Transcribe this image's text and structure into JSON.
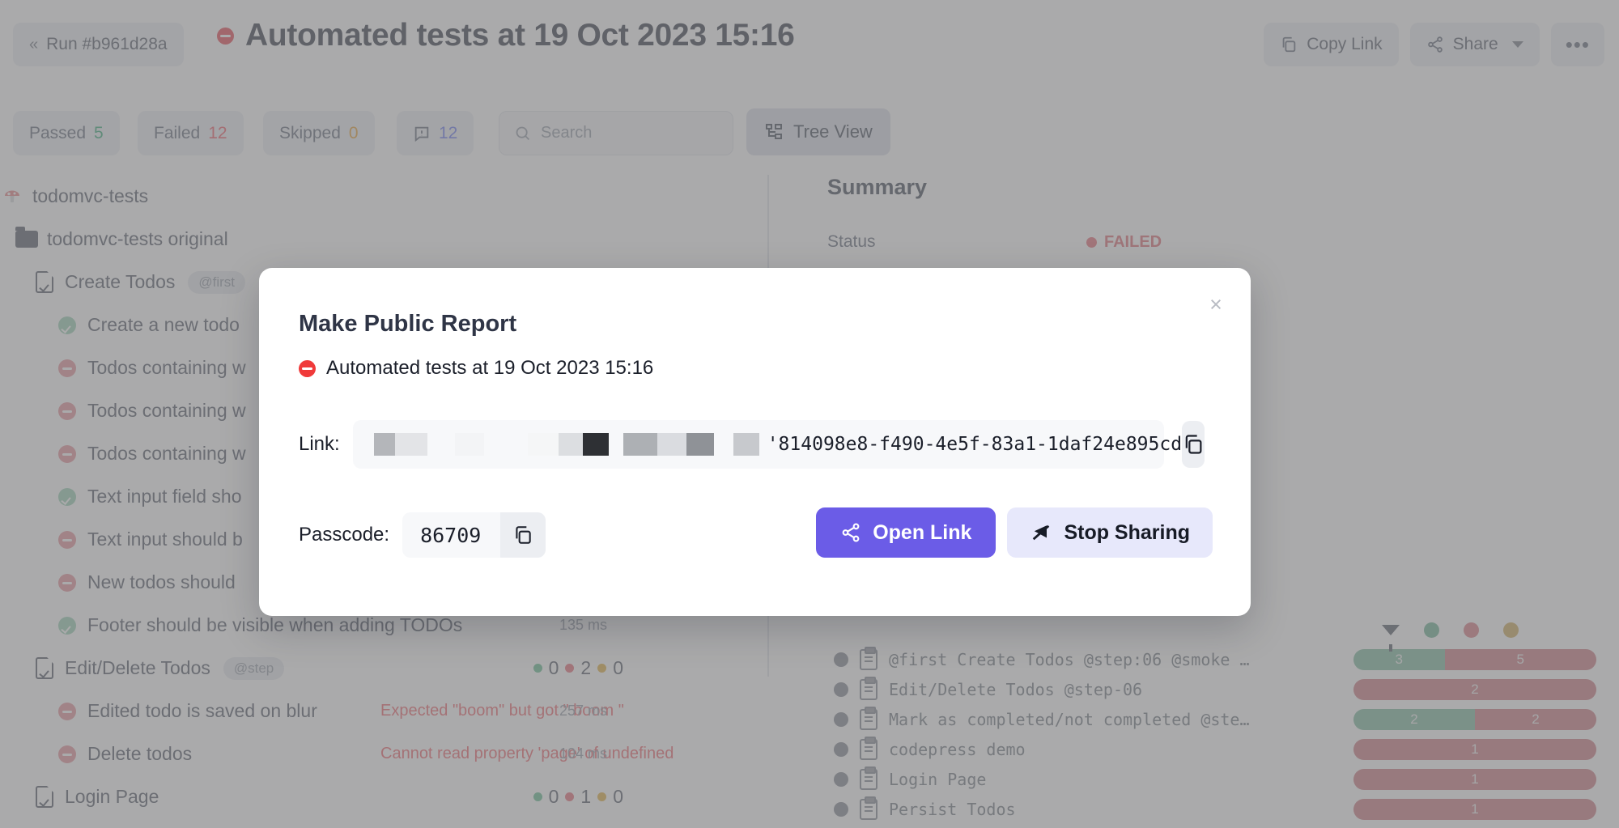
{
  "header": {
    "run_chip": "Run #b961d28a",
    "back_icon": "chevron-double-left-icon",
    "title": "Automated tests at 19 Oct 2023 15:16",
    "status_icon": "failed-circle-icon",
    "copy_link_label": "Copy Link",
    "share_label": "Share",
    "more_label": "•••"
  },
  "filters": {
    "passed_label": "Passed",
    "passed_count": "5",
    "failed_label": "Failed",
    "failed_count": "12",
    "skipped_label": "Skipped",
    "skipped_count": "0",
    "notes_count": "12",
    "search_placeholder": "Search",
    "search_value": "",
    "tree_view_label": "Tree View"
  },
  "tree": {
    "root": "todomvc-tests",
    "folder": "todomvc-tests original",
    "suite1": {
      "name": "Create Todos",
      "tag": "@first"
    },
    "tests1": [
      {
        "status": "passed",
        "name": "Create a new todo"
      },
      {
        "status": "failed",
        "name": "Todos containing w"
      },
      {
        "status": "failed",
        "name": "Todos containing w"
      },
      {
        "status": "failed",
        "name": "Todos containing w"
      },
      {
        "status": "passed",
        "name": "Text input field sho"
      },
      {
        "status": "failed",
        "name": "Text input should b"
      },
      {
        "status": "failed",
        "name": "New todos should"
      },
      {
        "status": "passed",
        "name": "Footer should be visible when adding TODOs",
        "duration": "135 ms"
      }
    ],
    "suite2": {
      "name": "Edit/Delete Todos",
      "tag": "@step",
      "pass": "0",
      "fail": "2",
      "skip": "0"
    },
    "tests2": [
      {
        "status": "failed",
        "name": "Edited todo is saved on blur",
        "error": "Expected \"boom\" but got \" boom \"",
        "duration": "257 ms"
      },
      {
        "status": "failed",
        "name": "Delete todos",
        "error": "Cannot read property 'page' of undefined",
        "duration": "104 ms"
      }
    ],
    "suite3": {
      "name": "Login Page",
      "pass": "0",
      "fail": "1",
      "skip": "0"
    }
  },
  "summary": {
    "title": "Summary",
    "status_label": "Status",
    "status_value": "FAILED"
  },
  "suites_panel": {
    "legend": [
      "filter-funnel-icon",
      "passed-dot",
      "failed-dot",
      "skipped-dot"
    ],
    "rows": [
      {
        "name": "@first Create Todos @step:06 @smoke …",
        "passed": 3,
        "failed": 5
      },
      {
        "name": "Edit/Delete Todos @step-06",
        "passed": 0,
        "failed": 2
      },
      {
        "name": "Mark as completed/not completed @ste…",
        "passed": 2,
        "failed": 2
      },
      {
        "name": "codepress demo",
        "passed": 0,
        "failed": 1
      },
      {
        "name": "Login Page",
        "passed": 0,
        "failed": 1
      },
      {
        "name": "Persist Todos",
        "passed": 0,
        "failed": 1
      }
    ]
  },
  "modal": {
    "heading": "Make Public Report",
    "report_name": "Automated tests at 19 Oct 2023 15:16",
    "report_status_icon": "failed-circle-icon",
    "close_label": "×",
    "link_label": "Link:",
    "link_value": "'814098e8-f490-4e5f-83a1-1daf24e895cd",
    "link_redacted": true,
    "copy_link_icon": "copy-icon",
    "passcode_label": "Passcode:",
    "passcode_value": "86709",
    "copy_passcode_icon": "copy-icon",
    "open_link_label": "Open Link",
    "stop_sharing_label": "Stop Sharing"
  },
  "colors": {
    "accent": "#6b5ce7",
    "accent_soft": "#e7e8fb",
    "passed": "#6cbf96",
    "failed": "#e8505b",
    "skipped": "#e3b34a"
  }
}
